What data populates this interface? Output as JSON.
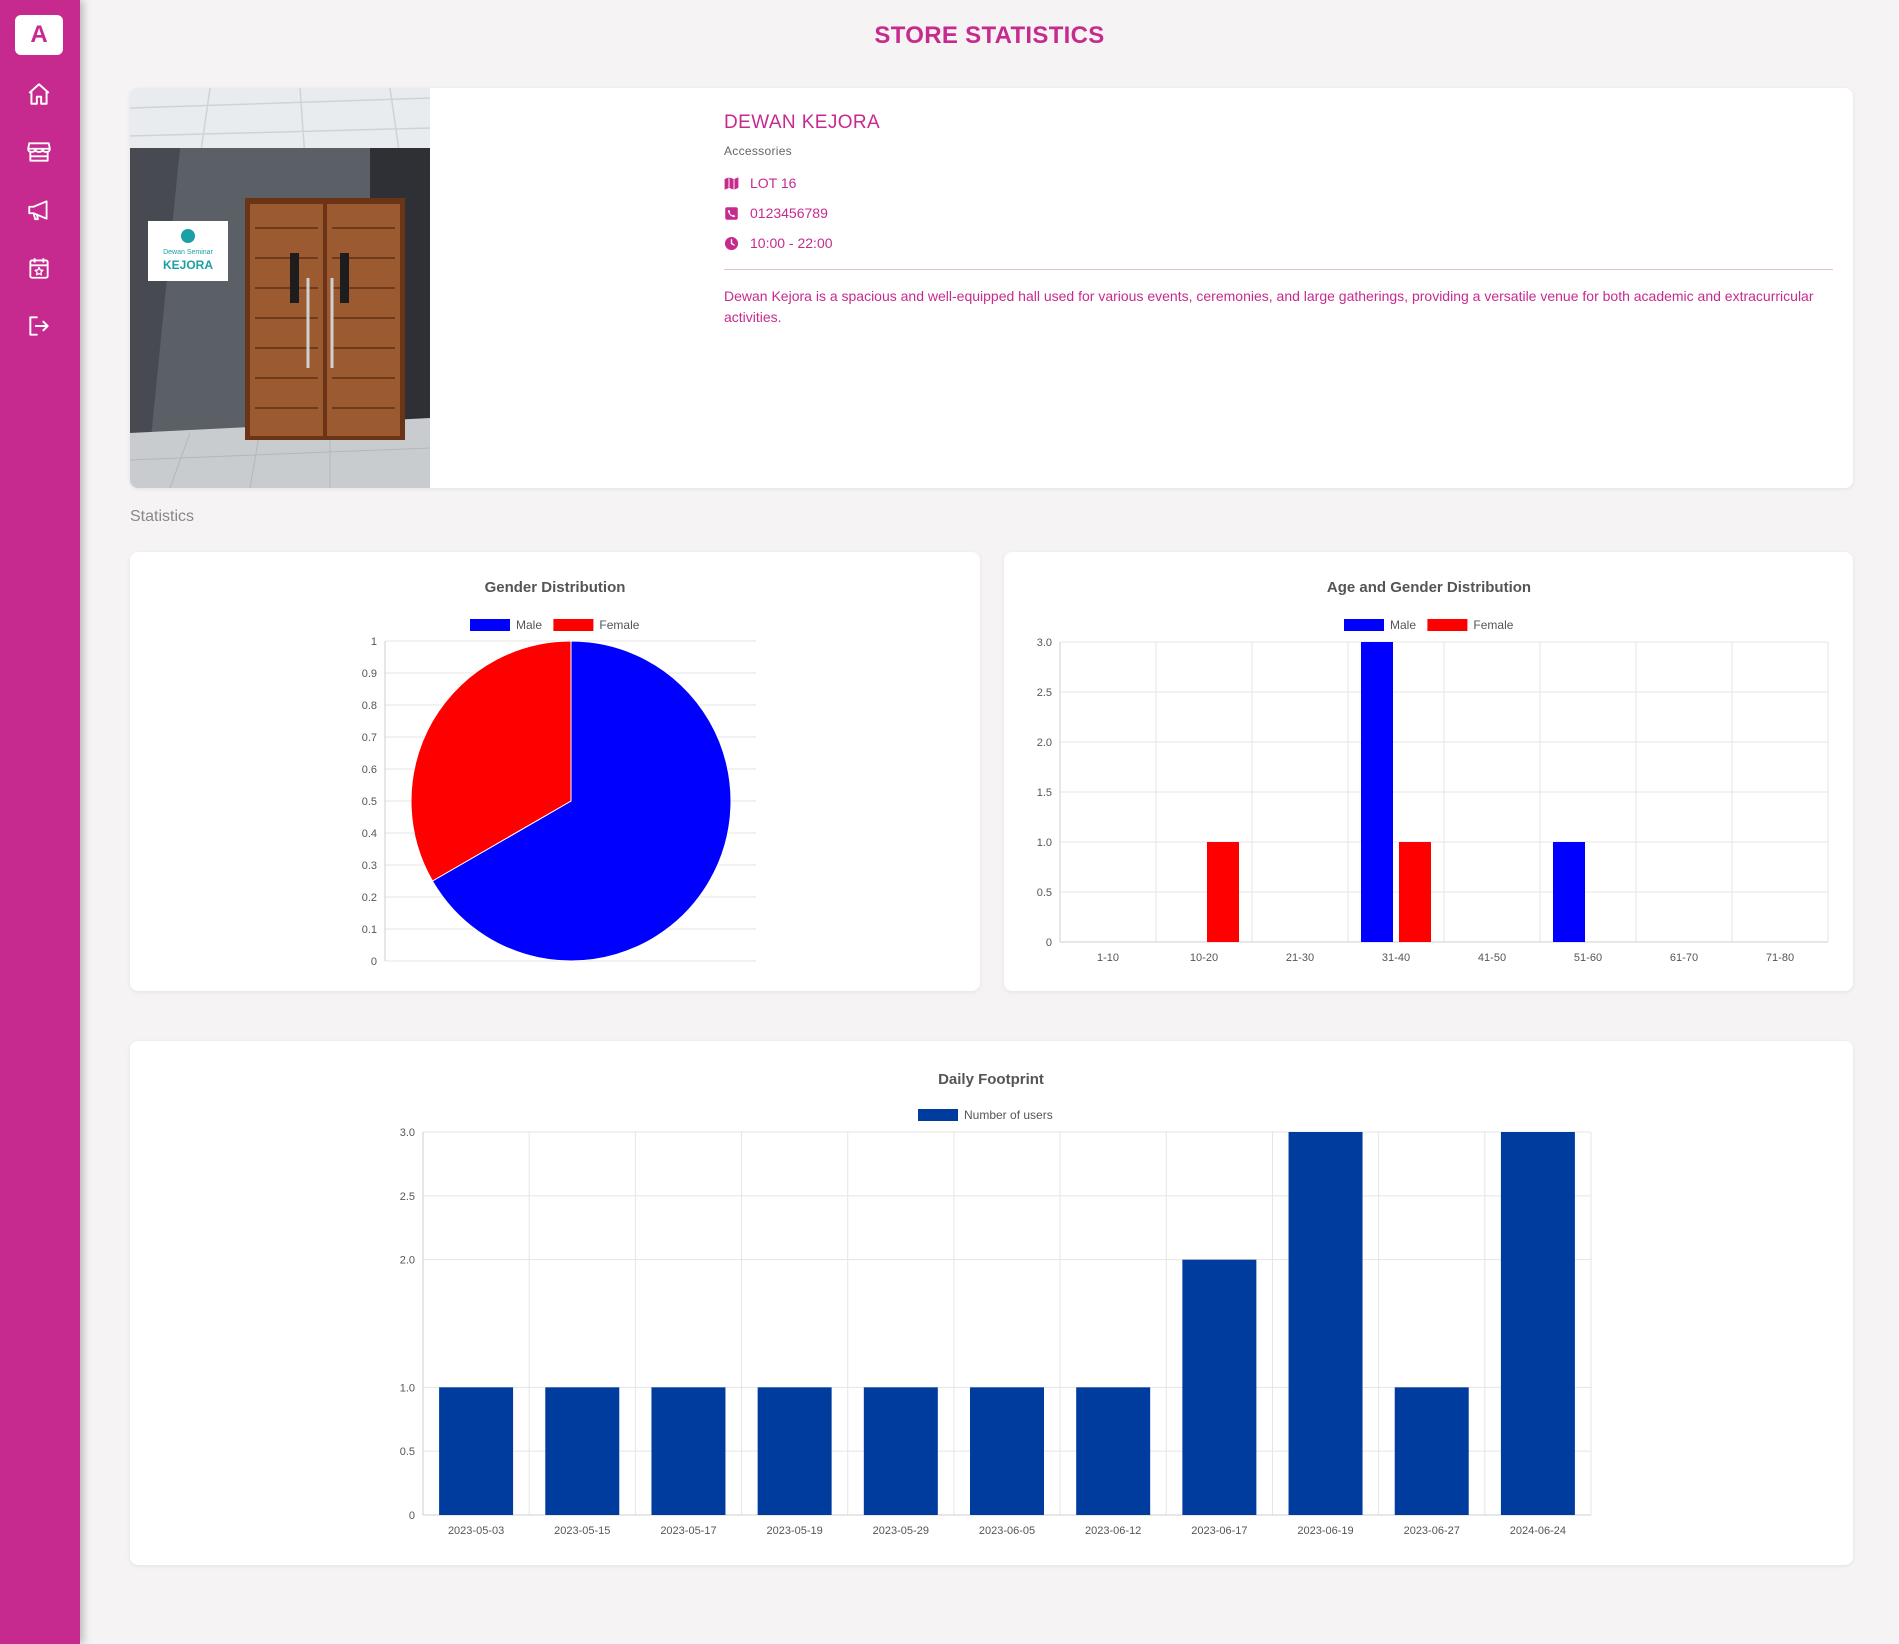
{
  "sidebar": {
    "logo": "A",
    "items": [
      {
        "icon": "home-icon"
      },
      {
        "icon": "store-icon"
      },
      {
        "icon": "megaphone-icon"
      },
      {
        "icon": "calendar-star-icon"
      },
      {
        "icon": "logout-icon"
      }
    ]
  },
  "page": {
    "title": "STORE STATISTICS"
  },
  "store": {
    "name": "DEWAN KEJORA",
    "category": "Accessories",
    "location": "LOT 16",
    "phone": "0123456789",
    "hours": "10:00 - 22:00",
    "description": "Dewan Kejora is a spacious and well-equipped hall used for various events, ceremonies, and large gatherings, providing a versatile venue for both academic and extracurricular activities.",
    "photo_sign": {
      "line1": "Dewan Seminar",
      "line2": "KEJORA"
    }
  },
  "sections": {
    "statistics_label": "Statistics"
  },
  "colors": {
    "accent": "#c72a8f",
    "male": "#0000ff",
    "female": "#ff0000",
    "users": "#003c9e"
  },
  "chart_data": [
    {
      "type": "pie",
      "title": "Gender Distribution",
      "labels": [
        "Male",
        "Female"
      ],
      "values": [
        4,
        2
      ],
      "y_ticks": [
        "0",
        "0.1",
        "0.2",
        "0.3",
        "0.4",
        "0.5",
        "0.6",
        "0.7",
        "0.8",
        "0.9",
        "1"
      ],
      "legend": "top"
    },
    {
      "type": "bar",
      "title": "Age and Gender Distribution",
      "categories": [
        "1-10",
        "10-20",
        "21-30",
        "31-40",
        "41-50",
        "51-60",
        "61-70",
        "71-80"
      ],
      "series": [
        {
          "name": "Male",
          "values": [
            0,
            0,
            0,
            3,
            0,
            1,
            0,
            0
          ]
        },
        {
          "name": "Female",
          "values": [
            0,
            1,
            0,
            1,
            0,
            0,
            0,
            0
          ]
        }
      ],
      "ylim": [
        0,
        3
      ],
      "y_ticks": [
        "0",
        "0.5",
        "1.0",
        "1.5",
        "2.0",
        "2.5",
        "3.0"
      ],
      "grid": true,
      "legend": "top"
    },
    {
      "type": "bar",
      "title": "Daily Footprint",
      "categories": [
        "2023-05-03",
        "2023-05-15",
        "2023-05-17",
        "2023-05-19",
        "2023-05-29",
        "2023-06-05",
        "2023-06-12",
        "2023-06-17",
        "2023-06-19",
        "2023-06-27",
        "2024-06-24"
      ],
      "series": [
        {
          "name": "Number of users",
          "values": [
            1,
            1,
            1,
            1,
            1,
            1,
            1,
            2,
            3,
            1,
            3
          ]
        }
      ],
      "ylim": [
        0,
        3
      ],
      "y_ticks": [
        "0",
        "0.5",
        "1.0",
        "2.0",
        "2.5",
        "3.0"
      ],
      "y_tick_values": [
        0,
        0.5,
        1,
        2,
        2.5,
        3
      ],
      "grid": true,
      "legend": "top"
    }
  ]
}
